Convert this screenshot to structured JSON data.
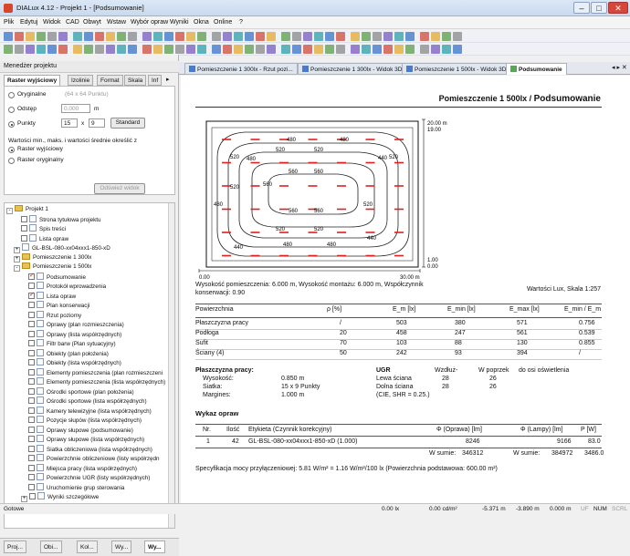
{
  "window": {
    "title": "DIALux 4.12 - Projekt 1 - [Podsumowanie]",
    "minimize": "–",
    "restore": "□",
    "close": "✕"
  },
  "menu": [
    "Plik",
    "Edytuj",
    "Widok",
    "CAD",
    "Obwyt",
    "Wstaw",
    "Wybór opraw",
    "Wyniki",
    "Okna",
    "Online",
    "?"
  ],
  "left_pane": {
    "title": "Menedżer projektu",
    "tabs": [
      "Raster wyjściowy",
      "Izolinie",
      "Format",
      "Skala",
      "Inf"
    ],
    "options": {
      "original_label": "Oryginalne",
      "original_hint": "(64 x 64 Punktu)",
      "offset_label": "Odstęp",
      "offset_value": "0.000",
      "offset_unit": "m",
      "points_label": "Punkty",
      "points_x": "15",
      "points_sep": "x",
      "points_y": "9",
      "standard_button": "Standard",
      "minmax_caption": "Wartości min., maks. i wartości średnie określić z",
      "raster_out": "Raster wyjściowy",
      "raster_orig": "Raster oryginalny",
      "refresh_button": "Odśwież widok"
    },
    "tree": [
      {
        "label": "Projekt 1",
        "level": 0,
        "kind": "folder",
        "expander": "-"
      },
      {
        "label": "Strona tytułowa projektu",
        "level": 2,
        "kind": "page"
      },
      {
        "label": "Spis treści",
        "level": 2,
        "kind": "page"
      },
      {
        "label": "Lista opraw",
        "level": 2,
        "kind": "page"
      },
      {
        "label": "GL-BSL-080-xx04xxx1-850-xD",
        "level": 1,
        "kind": "page",
        "expander": "+"
      },
      {
        "label": "Pomieszczenie 1 300lx",
        "level": 1,
        "kind": "folder",
        "expander": "+"
      },
      {
        "label": "Pomieszczenie 1 500lx",
        "level": 1,
        "kind": "folder",
        "expander": "-"
      },
      {
        "label": "Podsumowanie",
        "level": 3,
        "kind": "page",
        "checked": true
      },
      {
        "label": "Protokół wprowadzenia",
        "level": 3,
        "kind": "page"
      },
      {
        "label": "Lista opraw",
        "level": 3,
        "kind": "page",
        "checked": true
      },
      {
        "label": "Plan konserwacji",
        "level": 3,
        "kind": "page"
      },
      {
        "label": "Rzut poziomy",
        "level": 3,
        "kind": "page"
      },
      {
        "label": "Oprawy (plan rozmieszczenia)",
        "level": 3,
        "kind": "page"
      },
      {
        "label": "Oprawy (lista współrzędnych)",
        "level": 3,
        "kind": "page"
      },
      {
        "label": "Filtr barw (Plan sytuacyjny)",
        "level": 3,
        "kind": "page"
      },
      {
        "label": "Obiekty (plan położenia)",
        "level": 3,
        "kind": "page"
      },
      {
        "label": "Obiekty (lista współrzędnych)",
        "level": 3,
        "kind": "page"
      },
      {
        "label": "Elementy pomieszczenia (plan rozmieszczeni",
        "level": 3,
        "kind": "page"
      },
      {
        "label": "Elementy pomieszczenia (lista współrzędnych)",
        "level": 3,
        "kind": "page"
      },
      {
        "label": "Ośrodki sportowe (plan położenia)",
        "level": 3,
        "kind": "page"
      },
      {
        "label": "Ośrodki sportowe (lista współrzędnych)",
        "level": 3,
        "kind": "page"
      },
      {
        "label": "Kamery telewizyjne (lista współrzędnych)",
        "level": 3,
        "kind": "page"
      },
      {
        "label": "Pozycje słupów (lista współrzędnych)",
        "level": 3,
        "kind": "page"
      },
      {
        "label": "Oprawy słupowe (podsumowanie)",
        "level": 3,
        "kind": "page"
      },
      {
        "label": "Oprawy słupowe (lista współrzędnych)",
        "level": 3,
        "kind": "page"
      },
      {
        "label": "Siatka obliczeniowa (lista współrzędnych)",
        "level": 3,
        "kind": "page"
      },
      {
        "label": "Powierzchnie obliczeniowe (listy współrzędn",
        "level": 3,
        "kind": "page"
      },
      {
        "label": "Miejsca pracy (lista współrzędnych)",
        "level": 3,
        "kind": "page"
      },
      {
        "label": "Powierzchnie UGR (listy współrzędnych)",
        "level": 3,
        "kind": "page"
      },
      {
        "label": "Uruchomienie grup sterowania",
        "level": 3,
        "kind": "page"
      },
      {
        "label": "Wyniki szczegółowe",
        "level": 2,
        "kind": "page",
        "expander": "+"
      }
    ],
    "bottom_tabs": [
      "Proj...",
      "Obi...",
      "Kol...",
      "Wy...",
      "Wy..."
    ]
  },
  "doc_tabs": [
    "Pomieszczenie 1 300lx - Rzut pozi...",
    "Pomieszczenie 1 300lx - Widok 3D",
    "Pomieszczenie 1 500lx - Widok 3D",
    "Podsumowanie"
  ],
  "report": {
    "room_title": "Pomieszczenie 1 500lx / ",
    "page_title": "Podsumowanie",
    "dim_top": "20.00 m",
    "dim_top2": "19.00",
    "dim_right_low1": "1.00",
    "dim_right_low2": "0.00",
    "axis_left": "0.00",
    "axis_right": "30.00 m",
    "contours": [
      "400",
      "440",
      "480",
      "520",
      "560",
      "560",
      "520",
      "480",
      "440",
      "400"
    ],
    "heights_line1": "Wysokość pomieszczenia: 6.000 m, Wysokość montażu: 6.000 m, Współczynnik",
    "heights_line2": "konserwacji: 0.90",
    "scale_note": "Wartości Lux, Skala 1:257",
    "surfaces": {
      "headers": [
        "Powierzchnia",
        "ρ [%]",
        "E_m [lx]",
        "E_min [lx]",
        "E_max [lx]",
        "E_min / E_m"
      ],
      "rows": [
        [
          "Płaszczyzna pracy",
          "/",
          "503",
          "380",
          "571",
          "0.756"
        ],
        [
          "Podłoga",
          "20",
          "458",
          "247",
          "561",
          "0.539"
        ],
        [
          "Sufit",
          "70",
          "103",
          "88",
          "130",
          "0.855"
        ],
        [
          "Ściany (4)",
          "50",
          "242",
          "93",
          "394",
          "/"
        ]
      ]
    },
    "workplane": {
      "title": "Płaszczyzna pracy:",
      "rows": [
        [
          "Wysokość:",
          "0.850 m"
        ],
        [
          "Siatka:",
          "15 x 9 Punkty"
        ],
        [
          "Margines:",
          "1.000 m"
        ]
      ]
    },
    "ugr": {
      "title": "UGR",
      "col1": "Wzdłuż-",
      "col2": "W poprzek",
      "col3": "do osi oświetlenia",
      "rows": [
        [
          "Lewa ściana",
          "28",
          "26"
        ],
        [
          "Dolna ściana",
          "28",
          "26"
        ]
      ],
      "note": "(CIE, SHR = 0.25.)"
    },
    "luminaires": {
      "title": "Wykaz opraw",
      "headers": [
        "Nr.",
        "Ilość",
        "Etykieta (Czynnik korekcyjny)",
        "Φ (Oprawa) [lm]",
        "Φ (Lampy) [lm]",
        "P [W]"
      ],
      "row": [
        "1",
        "42",
        "GL-BSL-080-xx04xxx1-850-xD (1.000)",
        "8246",
        "9166",
        "83.0"
      ],
      "sum_label1": "W sumie:",
      "sum1": "346312",
      "sum_label2": "W sumie:",
      "sum2": "384972",
      "sum3": "3486.0"
    },
    "power_spec": "Specyfikacja mocy przyłączeniowej: 5.81 W/m² = 1.16 W/m²/100 lx (Powierzchnia podstawowa: 600.00 m²)"
  },
  "status": {
    "ready": "Gotowe",
    "lx": "0.00 lx",
    "lum": "0.00 cd/m²",
    "x": "-5.371 m",
    "y": "-3.890 m",
    "z": "0.000 m",
    "uf": "UF",
    "num": "NUM",
    "scrl": "SCRL"
  },
  "colors": {
    "accent": "#4a7bc8",
    "luminaire": "#e02020",
    "title_bar": "#c9daef"
  }
}
